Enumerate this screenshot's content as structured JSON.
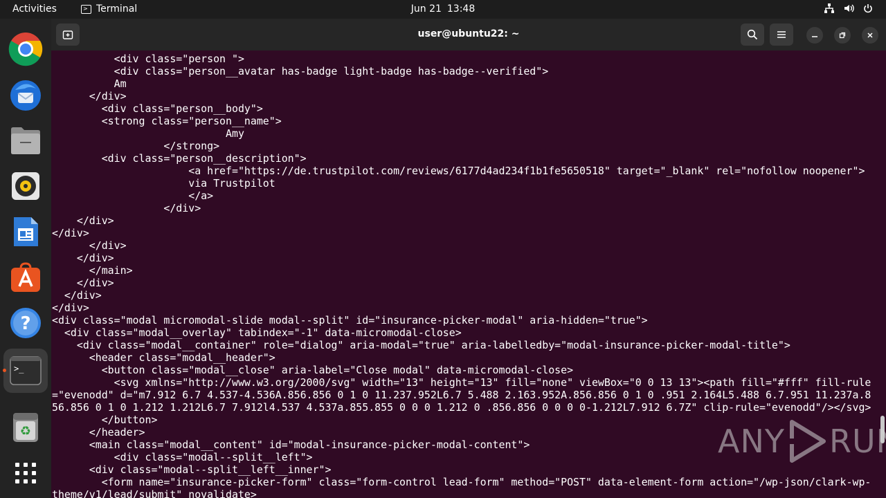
{
  "topbar": {
    "activities": "Activities",
    "app_name": "Terminal",
    "date": "Jun 21",
    "time": "13:48",
    "tray_icons": [
      "network-icon",
      "volume-icon",
      "power-icon"
    ]
  },
  "dock": {
    "items": [
      "chrome-icon",
      "thunderbird-icon",
      "files-icon",
      "rhythmbox-icon",
      "writer-icon",
      "app-center-icon",
      "help-icon",
      "terminal-icon",
      "trash-icon",
      "show-apps-icon"
    ],
    "active": "terminal-icon"
  },
  "window": {
    "title": "user@ubuntu22: ~",
    "buttons": [
      "new-tab-button",
      "search-button",
      "menu-button",
      "minimize-button",
      "maximize-button",
      "close-button"
    ]
  },
  "terminal": {
    "background": "#300a24",
    "foreground": "#ffffff",
    "lines": [
      "          <div class=\"person \">",
      "          <div class=\"person__avatar has-badge light-badge has-badge--verified\">",
      "          Am",
      "      </div>",
      "        <div class=\"person__body\">",
      "        <strong class=\"person__name\">",
      "                            Amy",
      "                  </strong>",
      "        <div class=\"person__description\">",
      "                      <a href=\"https://de.trustpilot.com/reviews/6177d4ad234f1b1fe5650518\" target=\"_blank\" rel=\"nofollow noopener\">",
      "                      via Trustpilot",
      "                      </a>",
      "                  </div>",
      "    </div>",
      "</div>",
      "      </div>",
      "    </div>",
      "      </main>",
      "    </div>",
      "  </div>",
      "</div>",
      "<div class=\"modal micromodal-slide modal--split\" id=\"insurance-picker-modal\" aria-hidden=\"true\">",
      "  <div class=\"modal__overlay\" tabindex=\"-1\" data-micromodal-close>",
      "    <div class=\"modal__container\" role=\"dialog\" aria-modal=\"true\" aria-labelledby=\"modal-insurance-picker-modal-title\">",
      "      <header class=\"modal__header\">",
      "        <button class=\"modal__close\" aria-label=\"Close modal\" data-micromodal-close>",
      "          <svg xmlns=\"http://www.w3.org/2000/svg\" width=\"13\" height=\"13\" fill=\"none\" viewBox=\"0 0 13 13\"><path fill=\"#fff\" fill-rule",
      "=\"evenodd\" d=\"m7.912 6.7 4.537-4.536A.856.856 0 1 0 11.237.952L6.7 5.488 2.163.952A.856.856 0 1 0 .951 2.164L5.488 6.7.951 11.237a.8",
      "56.856 0 1 0 1.212 1.212L6.7 7.912l4.537 4.537a.855.855 0 0 0 1.212 0 .856.856 0 0 0 0-1.212L7.912 6.7Z\" clip-rule=\"evenodd\"/></svg>",
      "        </button>",
      "      </header>",
      "      <main class=\"modal__content\" id=\"modal-insurance-picker-modal-content\">",
      "          <div class=\"modal--split__left\">",
      "      <div class=\"modal--split__left__inner\">",
      "        <form name=\"insurance-picker-form\" class=\"form-control lead-form\" method=\"POST\" data-element-form action=\"/wp-json/clark-wp-",
      "theme/v1/lead/submit\" novalidate>"
    ]
  },
  "watermark": {
    "text_left": "ANY",
    "text_right": "RUN"
  }
}
